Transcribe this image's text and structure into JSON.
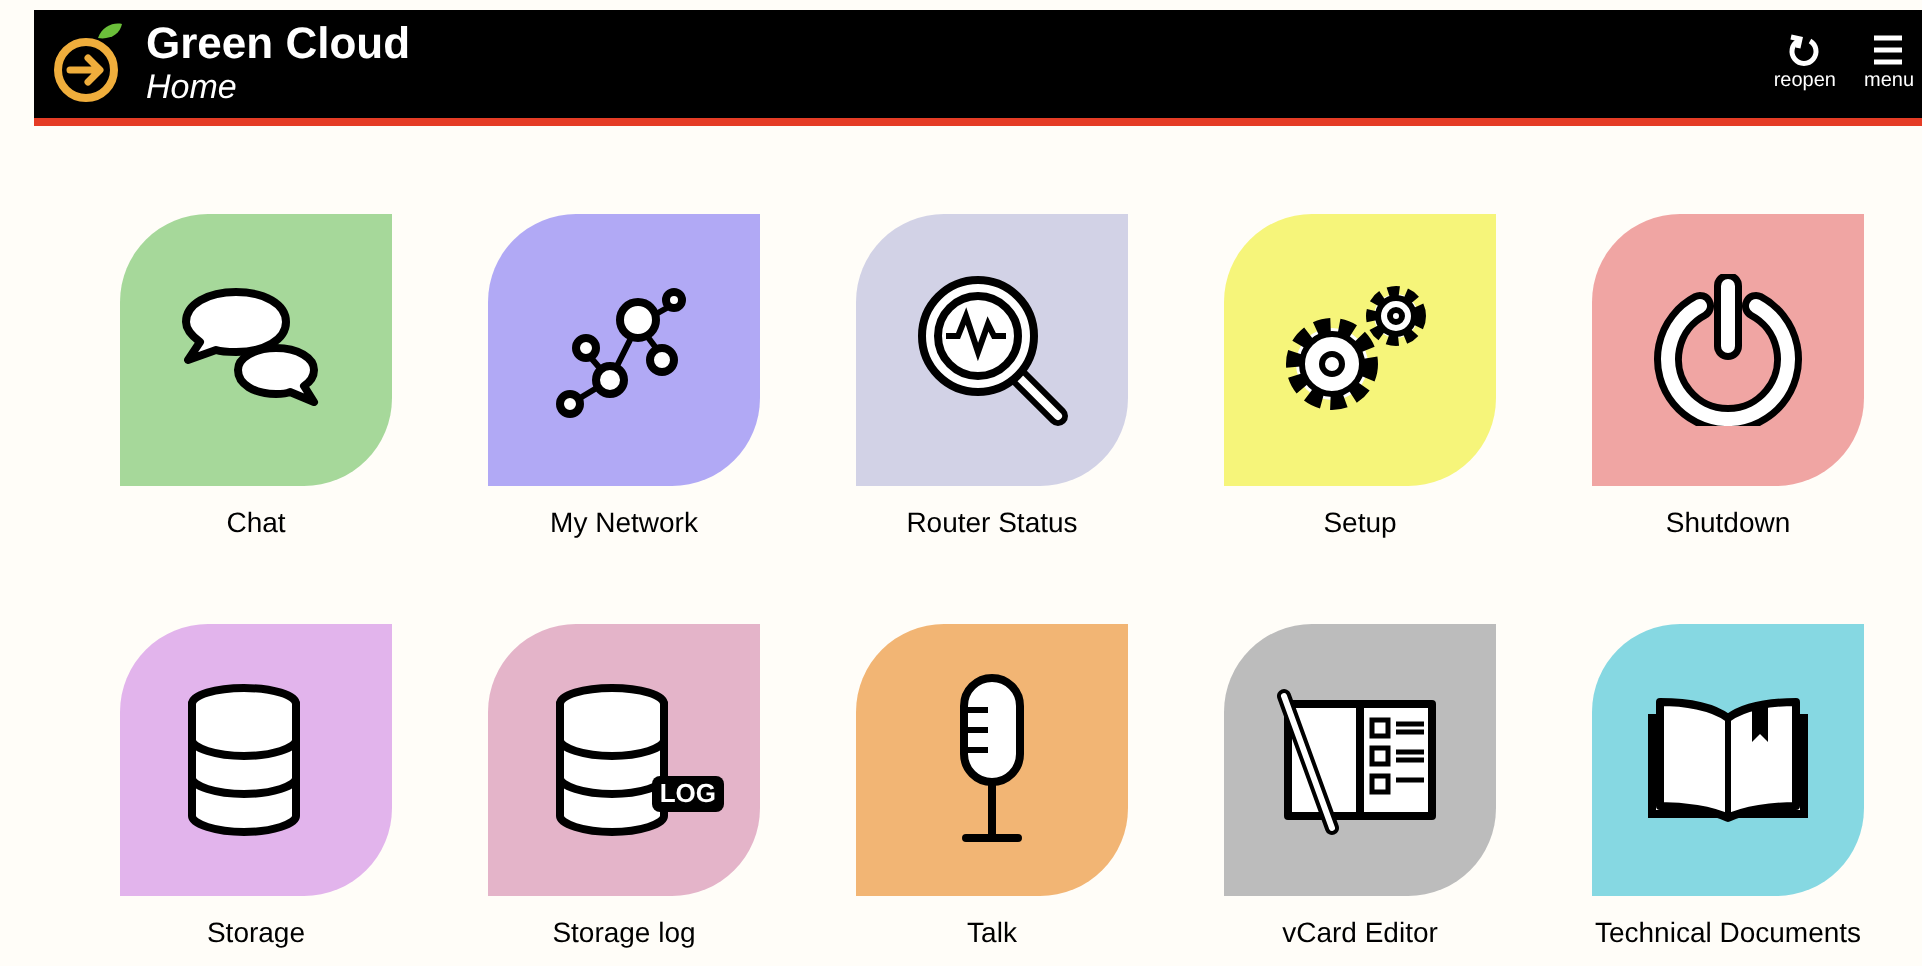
{
  "header": {
    "title": "Green Cloud",
    "subtitle": "Home",
    "actions": [
      {
        "kind": "reopen",
        "label": "reopen"
      },
      {
        "kind": "menu",
        "label": "menu"
      }
    ]
  },
  "tiles": [
    {
      "kind": "chat",
      "label": "Chat",
      "color": "#a6d89a"
    },
    {
      "kind": "network",
      "label": "My Network",
      "color": "#b1a9f5"
    },
    {
      "kind": "status",
      "label": "Router Status",
      "color": "#d2d2e6"
    },
    {
      "kind": "setup",
      "label": "Setup",
      "color": "#f6f57a"
    },
    {
      "kind": "shutdown",
      "label": "Shutdown",
      "color": "#f0a5a3"
    },
    {
      "kind": "storage",
      "label": "Storage",
      "color": "#e2b4ec"
    },
    {
      "kind": "storagelog",
      "label": "Storage log",
      "color": "#e4b4c9",
      "badge": "LOG"
    },
    {
      "kind": "talk",
      "label": "Talk",
      "color": "#f2b574"
    },
    {
      "kind": "vcard",
      "label": "vCard Editor",
      "color": "#bcbcbc"
    },
    {
      "kind": "docs",
      "label": "Technical Documents",
      "color": "#86d8e2"
    }
  ]
}
